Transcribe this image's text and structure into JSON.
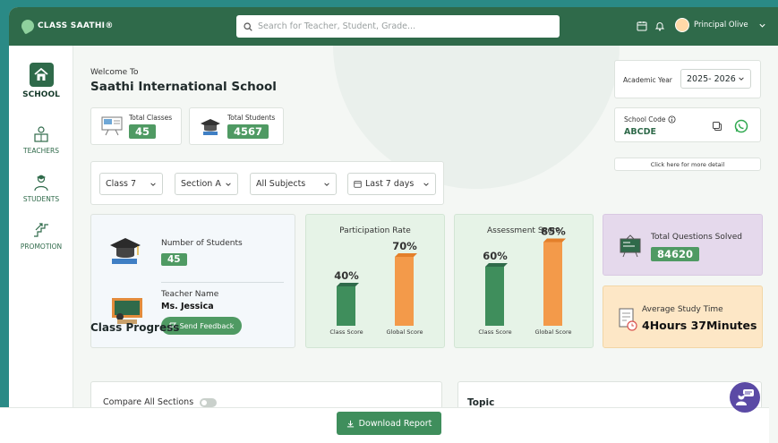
{
  "app": {
    "logo_text": "CLASS SAATHI®"
  },
  "search": {
    "placeholder": "Search for Teacher, Student, Grade..."
  },
  "profile": {
    "name": "Principal Olive"
  },
  "sidebar": {
    "items": [
      {
        "label": "SCHOOL",
        "icon": "home-icon",
        "active": true
      },
      {
        "label": "TEACHERS",
        "icon": "teacher-icon"
      },
      {
        "label": "STUDENTS",
        "icon": "student-icon"
      },
      {
        "label": "PROMOTION",
        "icon": "promotion-icon"
      }
    ]
  },
  "welcome": {
    "line1": "Welcome  To",
    "school_name": "Saathi International School"
  },
  "stats": {
    "total_classes_label": "Total Classes",
    "total_classes_value": "45",
    "total_students_label": "Total Students",
    "total_students_value": "4567"
  },
  "filters": {
    "class": "Class 7",
    "section": "Section A",
    "subjects": "All Subjects",
    "period": "Last 7 days"
  },
  "academic_year": {
    "label": "Academic Year",
    "value": "2025- 2026"
  },
  "school_code": {
    "label": "School Code",
    "value": "ABCDE",
    "more_link": "Click here for more detail"
  },
  "class_info": {
    "students_label": "Number of Students",
    "students_value": "45",
    "teacher_label": "Teacher Name",
    "teacher_value": "Ms. Jessica",
    "feedback_button": "Send Feedback"
  },
  "participation": {
    "title": "Participation Rate",
    "bars": [
      {
        "label": "Class Score",
        "pct_label": "40%",
        "value": 40
      },
      {
        "label": "Global Score",
        "pct_label": "70%",
        "value": 70
      }
    ]
  },
  "assessment": {
    "title": "Assessment Score",
    "bars": [
      {
        "label": "Class Score",
        "pct_label": "60%",
        "value": 60
      },
      {
        "label": "Global Score",
        "pct_label": "85%",
        "value": 85
      }
    ]
  },
  "questions": {
    "label": "Total Questions Solved",
    "value": "84620"
  },
  "study_time": {
    "label": "Average Study Time",
    "value": "4Hours 37Minutes"
  },
  "progress": {
    "title": "Class Progress",
    "compare_label": "Compare All Sections",
    "topic_title": "Topic"
  },
  "download": {
    "label": "Download Report"
  },
  "colors": {
    "brand": "#2f6a4a",
    "accent_green": "#4f9a63",
    "orange": "#f39a4a",
    "purple_card": "#e5d9ec",
    "peach_card": "#fde7c6",
    "green_card": "#e6f3e7"
  }
}
